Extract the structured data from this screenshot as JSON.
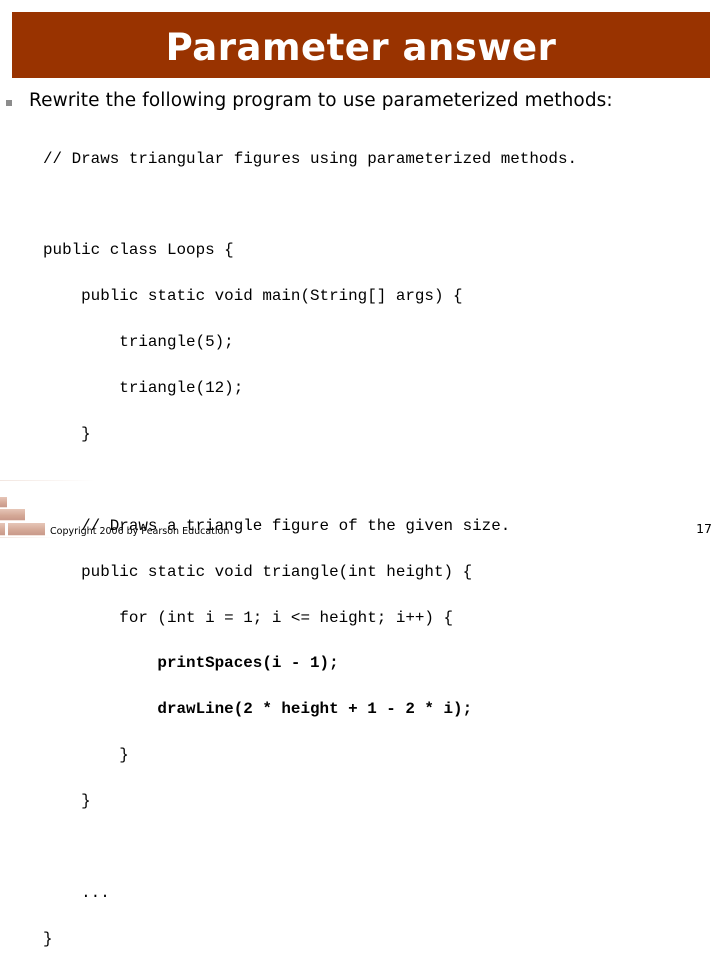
{
  "slide": {
    "title": "Parameter answer",
    "title_bar_color": "#993300",
    "bullet": {
      "icon": "square-bullet-icon",
      "text": "Rewrite the following program to use parameterized methods:"
    },
    "code": {
      "lines": [
        {
          "text": "// Draws triangular figures using parameterized methods.",
          "bold": false
        },
        {
          "text": "",
          "bold": false
        },
        {
          "text": "public class Loops {",
          "bold": false
        },
        {
          "text": "    public static void main(String[] args) {",
          "bold": false
        },
        {
          "text": "        triangle(5);",
          "bold": false
        },
        {
          "text": "        triangle(12);",
          "bold": false
        },
        {
          "text": "    }",
          "bold": false
        },
        {
          "text": "",
          "bold": false
        },
        {
          "text": "    // Draws a triangle figure of the given size.",
          "bold": false
        },
        {
          "text": "    public static void triangle(int height) {",
          "bold": false
        },
        {
          "text": "        for (int i = 1; i <= height; i++) {",
          "bold": false
        },
        {
          "text": "            printSpaces(i - 1);",
          "bold": true
        },
        {
          "text": "            drawLine(2 * height + 1 - 2 * i);",
          "bold": true
        },
        {
          "text": "        }",
          "bold": false
        },
        {
          "text": "    }",
          "bold": false
        },
        {
          "text": "",
          "bold": false
        },
        {
          "text": "    ...",
          "bold": false
        },
        {
          "text": "}",
          "bold": false
        }
      ]
    },
    "footer": {
      "decoration": "brick-wall-icon",
      "copyright": "Copyright 2006 by Pearson Education",
      "page_number": "17"
    }
  }
}
